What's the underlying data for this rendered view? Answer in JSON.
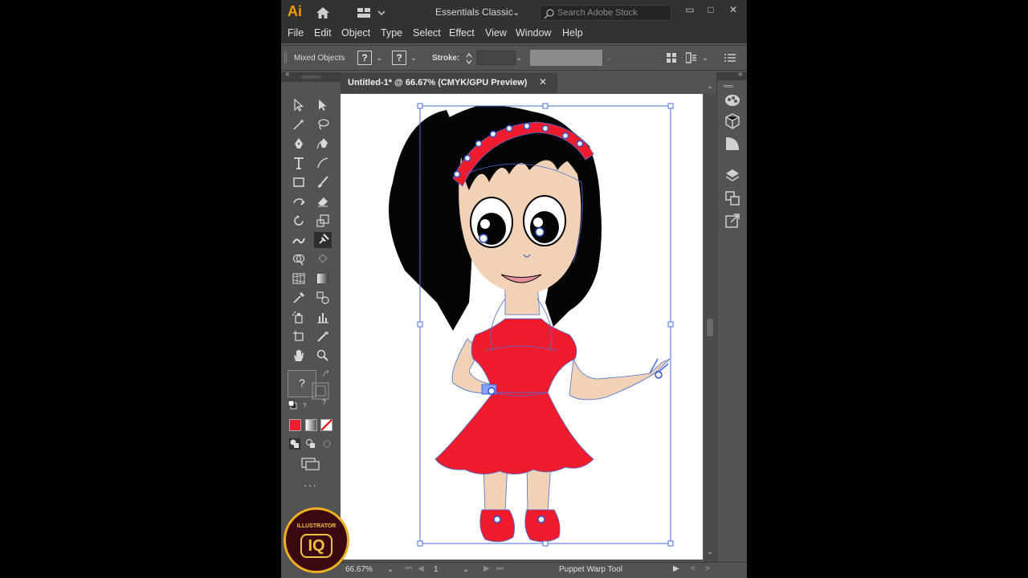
{
  "app": {
    "logo": "Ai",
    "workspace": "Essentials Classic"
  },
  "search": {
    "placeholder": "Search Adobe Stock"
  },
  "window_controls": {
    "minimize": "▭",
    "maximize": "□",
    "close": "✕"
  },
  "menu": [
    "File",
    "Edit",
    "Object",
    "Type",
    "Select",
    "Effect",
    "View",
    "Window",
    "Help"
  ],
  "control_bar": {
    "selection_label": "Mixed Objects",
    "fill_value": "?",
    "stroke_value": "?",
    "stroke_label": "Stroke:"
  },
  "document": {
    "tab_title": "Untitled-1* @ 66.67% (CMYK/GPU Preview)",
    "close": "✕"
  },
  "toolbox": {
    "fill_unknown": "?"
  },
  "status": {
    "zoom": "66.67%",
    "page": "1",
    "current_tool": "Puppet Warp Tool"
  },
  "badge": {
    "line1": "ILLUSTRATOR",
    "line2": "IQ"
  },
  "colors": {
    "accent": "#ff9a00",
    "dress_red": "#ee1c2d",
    "skin": "#f2d2b6",
    "hair": "#050505",
    "selection_blue": "#4a6fd8",
    "pin_blue": "#2f55d4"
  }
}
